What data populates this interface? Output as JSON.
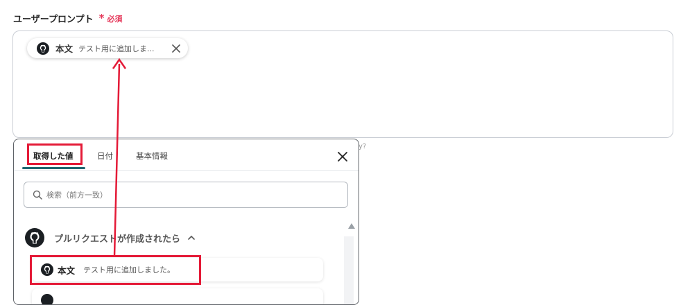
{
  "field": {
    "label": "ユーザープロンプト",
    "required_star": "*",
    "required_text": "必須"
  },
  "chip": {
    "name": "本文",
    "value": "テスト用に追加しま...",
    "icon": "github-icon"
  },
  "hint_tail": "y?",
  "panel": {
    "tabs": [
      {
        "label": "取得した値",
        "active": true
      },
      {
        "label": "日付",
        "active": false
      },
      {
        "label": "基本情報",
        "active": false
      }
    ],
    "search_placeholder": "検索（前方一致）",
    "group": {
      "title": "プルリクエストが作成されたら",
      "icon": "github-icon",
      "expanded": true
    },
    "items": [
      {
        "name": "本文",
        "value": "テスト用に追加しました。",
        "icon": "github-icon"
      }
    ]
  },
  "colors": {
    "accent": "#1f6670",
    "required": "#e5385a",
    "highlight": "#e41a37"
  }
}
